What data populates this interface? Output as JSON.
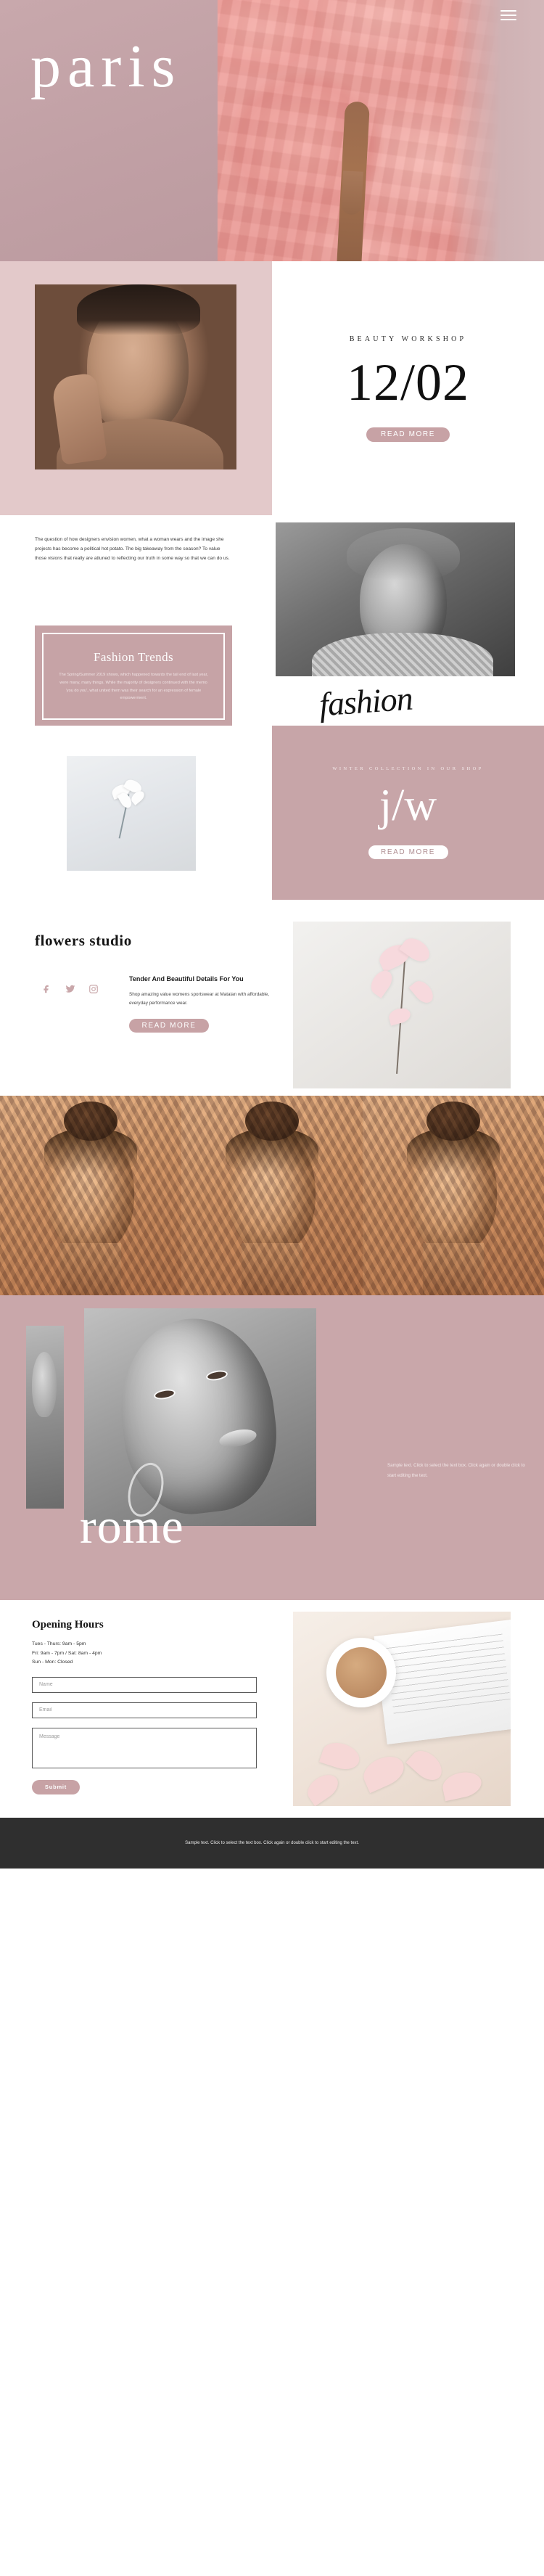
{
  "site": {
    "hero_title": "paris",
    "menu_icon": "hamburger-menu-icon"
  },
  "workshop": {
    "eyebrow": "BEAUTY WORKSHOP",
    "date": "12/02",
    "cta": "READ MORE"
  },
  "intro": {
    "paragraph": "The question of how designers envision women, what a woman wears and the image she projects has become a political hot potato. The big takeaway from the season? To value those visions that really are attuned to reflecting our truth in some way so that we can do us."
  },
  "trends": {
    "title": "Fashion Trends",
    "body": "The Spring/Summer 2019 shows, which happened towards the tail end of last year, were many, many things. While the majority of designers continued with the memo 'you do you', what united them was their search for an expression of female empowerment.",
    "script_word": "fashion"
  },
  "collection": {
    "eyebrow": "WINTER COLLECTION IN OUR SHOP",
    "logo": "j/w",
    "cta": "READ MORE"
  },
  "flowers": {
    "title": "flowers studio",
    "promo_title": "Tender And Beautiful Details For You",
    "promo_body": "Shop amazing value womens sportswear at Matalan with affordable, everyday performance wear.",
    "cta": "READ MORE",
    "social": [
      {
        "name": "facebook-icon",
        "label": "Facebook"
      },
      {
        "name": "twitter-icon",
        "label": "Twitter"
      },
      {
        "name": "instagram-icon",
        "label": "Instagram"
      }
    ]
  },
  "rome": {
    "word": "rome",
    "sample_text": "Sample text. Click to select the text box. Click again or double click to start editing the text."
  },
  "contact": {
    "title": "Opening Hours",
    "hours": [
      "Tues - Thurs: 9am - 5pm",
      "Fri: 9am - 7pm / Sat: 8am - 4pm",
      "Sun - Mon: Closed"
    ],
    "name_placeholder": "Name",
    "email_placeholder": "Email",
    "message_placeholder": "Message",
    "name_value": "",
    "email_value": "",
    "message_value": "",
    "submit_label": "Submit"
  },
  "footer": {
    "text": "Sample text. Click to select the text box. Click again or double click to start editing the text."
  },
  "colors": {
    "rose": "#c9a7aa",
    "rose_light": "#e3c9ca",
    "rose_button": "#c7a2a5",
    "dark": "#2f2f2f",
    "white": "#ffffff"
  }
}
